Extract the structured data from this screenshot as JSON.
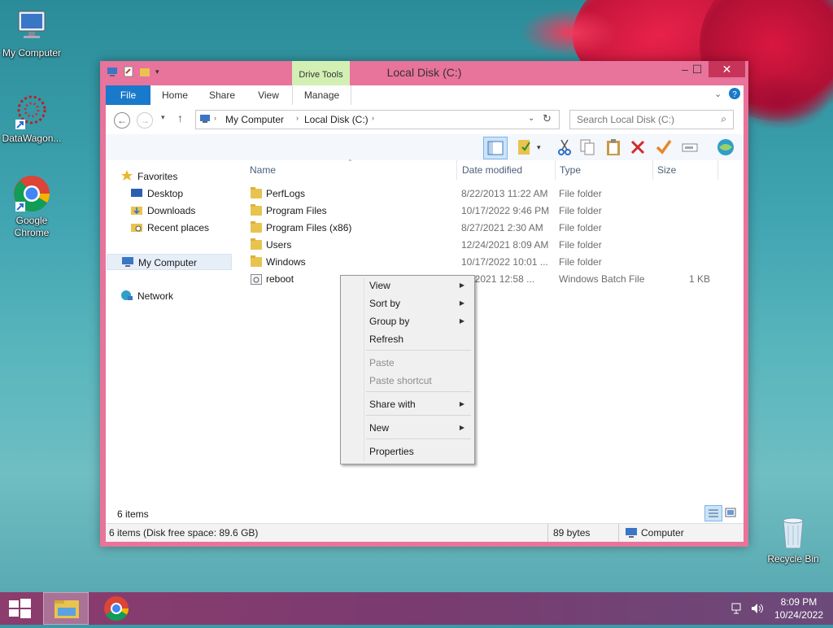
{
  "desktop": {
    "icons": [
      {
        "label": "My Computer"
      },
      {
        "label": "DataWagon..."
      },
      {
        "label": "Google Chrome"
      },
      {
        "label": "Recycle Bin"
      }
    ]
  },
  "window": {
    "title": "Local Disk (C:)",
    "contextual_tab_group": "Drive Tools",
    "tabs": [
      "File",
      "Home",
      "Share",
      "View",
      "Manage"
    ],
    "breadcrumb": [
      "My Computer",
      "Local Disk (C:)"
    ],
    "search_placeholder": "Search Local Disk (C:)",
    "nav": {
      "favorites": "Favorites",
      "favorites_items": [
        "Desktop",
        "Downloads",
        "Recent places"
      ],
      "my_computer": "My Computer",
      "network": "Network"
    },
    "columns": [
      "Name",
      "Date modified",
      "Type",
      "Size"
    ],
    "files": [
      {
        "name": "PerfLogs",
        "date": "8/22/2013 11:22 AM",
        "type": "File folder",
        "size": "",
        "kind": "folder"
      },
      {
        "name": "Program Files",
        "date": "10/17/2022 9:46 PM",
        "type": "File folder",
        "size": "",
        "kind": "folder"
      },
      {
        "name": "Program Files (x86)",
        "date": "8/27/2021 2:30 AM",
        "type": "File folder",
        "size": "",
        "kind": "folder"
      },
      {
        "name": "Users",
        "date": "12/24/2021 8:09 AM",
        "type": "File folder",
        "size": "",
        "kind": "folder"
      },
      {
        "name": "Windows",
        "date": "10/17/2022 10:01 ...",
        "type": "File folder",
        "size": "",
        "kind": "folder"
      },
      {
        "name": "reboot",
        "date": "23/2021 12:58 ...",
        "type": "Windows Batch File",
        "size": "1 KB",
        "kind": "batch"
      }
    ],
    "item_count": "6 items",
    "status_left": "6 items (Disk free space: 89.6 GB)",
    "status_size": "89 bytes",
    "status_location": "Computer"
  },
  "context_menu": {
    "items": [
      {
        "label": "View",
        "submenu": true,
        "disabled": false
      },
      {
        "label": "Sort by",
        "submenu": true,
        "disabled": false
      },
      {
        "label": "Group by",
        "submenu": true,
        "disabled": false
      },
      {
        "label": "Refresh",
        "submenu": false,
        "disabled": false
      },
      {
        "label": "Paste",
        "submenu": false,
        "disabled": true
      },
      {
        "label": "Paste shortcut",
        "submenu": false,
        "disabled": true
      },
      {
        "label": "Share with",
        "submenu": true,
        "disabled": false
      },
      {
        "label": "New",
        "submenu": true,
        "disabled": false
      },
      {
        "label": "Properties",
        "submenu": false,
        "disabled": false
      }
    ]
  },
  "taskbar": {
    "time": "8:09 PM",
    "date": "10/24/2022"
  },
  "colors": {
    "window_frame": "#e8739b",
    "file_tab": "#1979ca",
    "close_button": "#c7345a",
    "drive_tools": "#d2f0b4"
  }
}
